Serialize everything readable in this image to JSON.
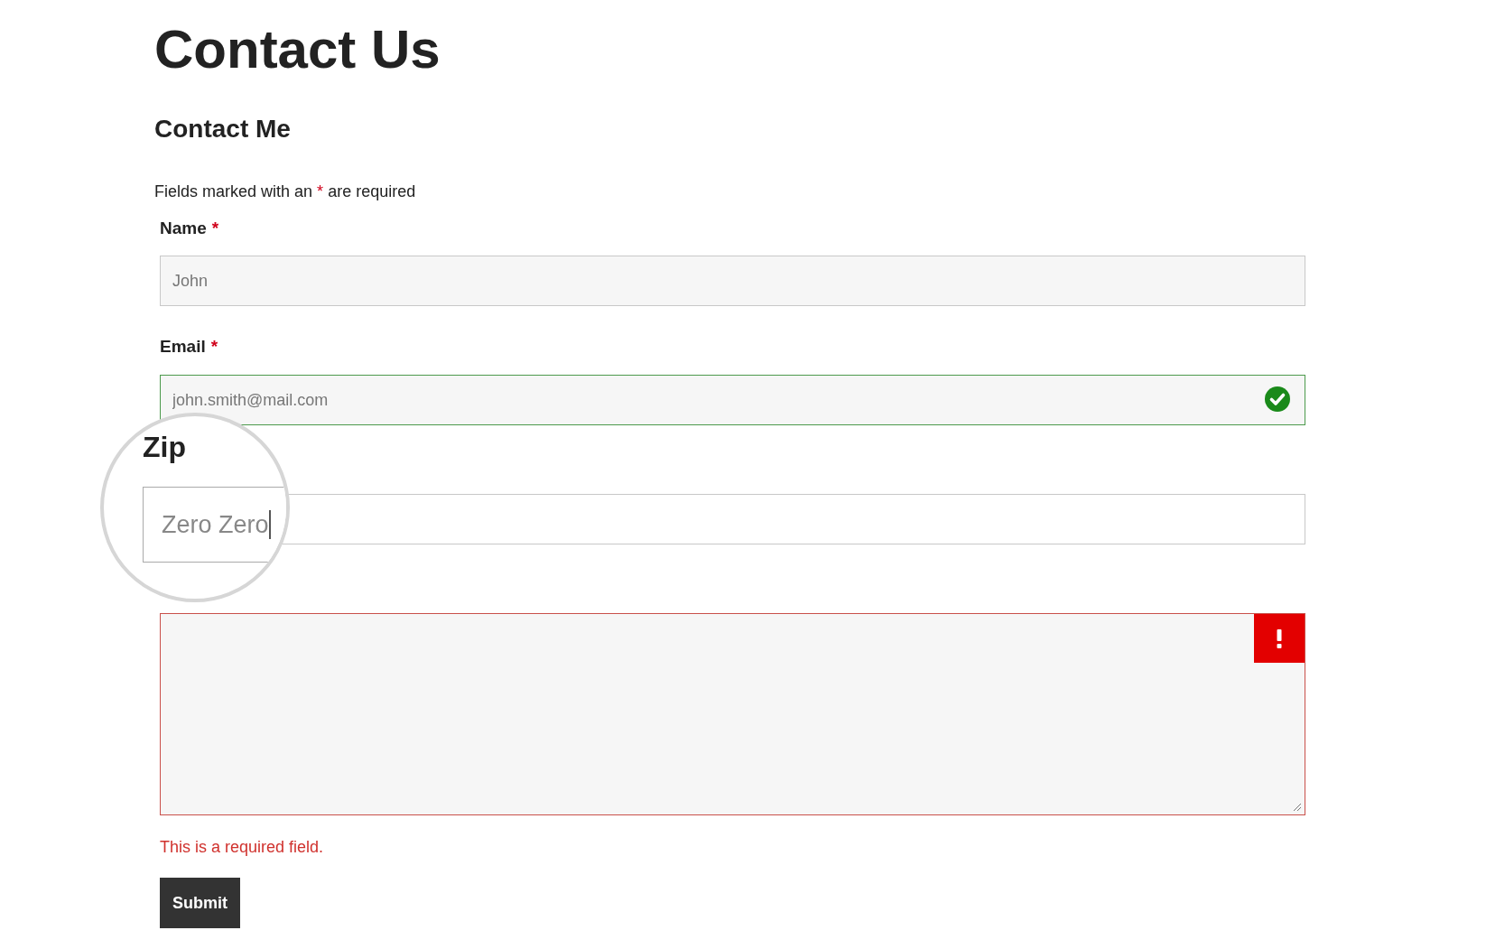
{
  "page_title": "Contact Us",
  "form_title": "Contact Me",
  "intro": {
    "before": "Fields marked with an",
    "mark": "*",
    "after": "are required"
  },
  "fields": [
    {
      "kind": "text",
      "label": "Name",
      "required_mark": "*",
      "placeholder": "John",
      "valid": false,
      "invalid": false
    },
    {
      "kind": "text",
      "label": "Email",
      "required_mark": "*",
      "value": "john.smith@mail.com",
      "valid": true,
      "invalid": false
    },
    {
      "kind": "text",
      "valid": false,
      "invalid": false
    },
    {
      "kind": "textarea",
      "valid": false,
      "invalid": true,
      "error": "This is a required field."
    }
  ],
  "magnifier": {
    "label": "Zip",
    "value": "Zero Zero"
  },
  "submit": "Submit"
}
